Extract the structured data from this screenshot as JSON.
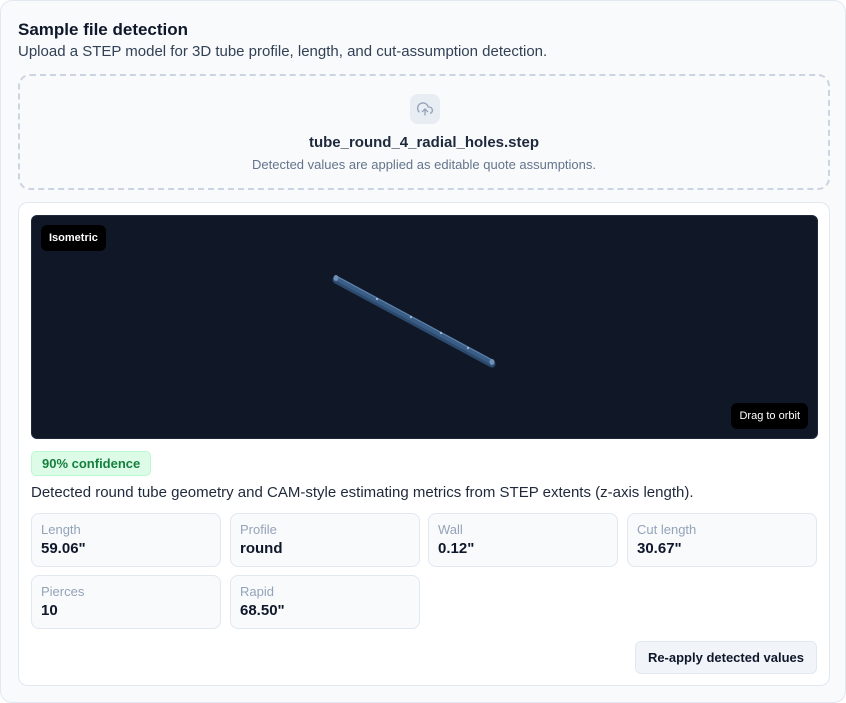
{
  "header": {
    "title": "Sample file detection",
    "subtitle": "Upload a STEP model for 3D tube profile, length, and cut-assumption detection."
  },
  "upload": {
    "icon": "cloud-upload-icon",
    "file_name": "tube_round_4_radial_holes.step",
    "hint": "Detected values are applied as editable quote assumptions."
  },
  "viewer": {
    "view_label": "Isometric",
    "orbit_hint": "Drag to orbit",
    "background": "#101828",
    "tube_color": "#3a5d86"
  },
  "detection": {
    "confidence_label": "90% confidence",
    "confidence_percent": 90,
    "summary": "Detected round tube geometry and CAM-style estimating metrics from STEP extents (z-axis length)."
  },
  "metrics": [
    {
      "label": "Length",
      "value": "59.06\""
    },
    {
      "label": "Profile",
      "value": "round"
    },
    {
      "label": "Wall",
      "value": "0.12\""
    },
    {
      "label": "Cut length",
      "value": "30.67\""
    },
    {
      "label": "Pierces",
      "value": "10"
    },
    {
      "label": "Rapid",
      "value": "68.50\""
    }
  ],
  "actions": {
    "reapply_label": "Re-apply detected values"
  },
  "colors": {
    "badge_bg": "#dcfce7",
    "badge_text": "#15803d",
    "accent_dark": "#0f172a"
  }
}
